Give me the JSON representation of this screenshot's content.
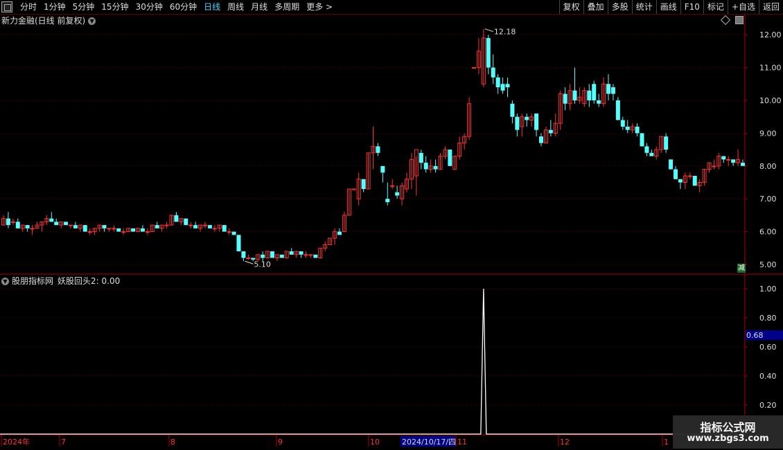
{
  "toolbar": {
    "periods": [
      "分时",
      "1分钟",
      "5分钟",
      "15分钟",
      "30分钟",
      "60分钟",
      "日线",
      "周线",
      "月线",
      "多周期",
      "更多 >"
    ],
    "active": "日线",
    "right_buttons": [
      "复权",
      "叠加",
      "多股",
      "统计",
      "画线",
      "F10",
      "标记",
      "+自选",
      "返回"
    ]
  },
  "main_chart": {
    "title": "新力金融(日线 前复权)",
    "y_ticks": [
      "12.00",
      "11.00",
      "10.00",
      "9.00",
      "8.00",
      "7.00",
      "6.00",
      "5.00"
    ],
    "annotations": {
      "high": "12.18",
      "low": "5.10"
    },
    "side_badge": "减"
  },
  "indicator": {
    "title": "股朋指标网",
    "formula_label": "妖股回头2: 0.00",
    "y_ticks": [
      "1.00",
      "0.80",
      "0.60",
      "0.40",
      "0.20"
    ],
    "cursor_value": "0.68"
  },
  "x_axis": {
    "labels": [
      "2024年",
      "7",
      "8",
      "9",
      "10",
      "11",
      "12",
      "1"
    ],
    "highlight": "2024/10/17/四"
  },
  "watermark": {
    "line1": "指标公式网",
    "line2": "www.zbgs3.com"
  },
  "colors": {
    "up": "#ff3232",
    "down": "#54ffff",
    "axis": "#b00000",
    "grid": "#5a0000",
    "indicator_line": "#ffffff"
  },
  "chart_data": {
    "type": "candlestick",
    "y_range": [
      5.0,
      12.2
    ],
    "indicator_y_range": [
      0,
      1.05
    ],
    "candles": [
      [
        6.2,
        6.5,
        6.2,
        6.4
      ],
      [
        6.4,
        6.6,
        6.1,
        6.2
      ],
      [
        6.3,
        6.4,
        6.2,
        6.3
      ],
      [
        6.3,
        6.4,
        6.1,
        6.1
      ],
      [
        6.1,
        6.2,
        6.0,
        6.2
      ],
      [
        6.2,
        6.2,
        6.0,
        6.1
      ],
      [
        6.1,
        6.2,
        5.9,
        6.1
      ],
      [
        6.1,
        6.3,
        6.1,
        6.2
      ],
      [
        6.2,
        6.3,
        6.0,
        6.3
      ],
      [
        6.3,
        6.5,
        6.2,
        6.4
      ],
      [
        6.4,
        6.6,
        6.3,
        6.3
      ],
      [
        6.3,
        6.4,
        6.2,
        6.2
      ],
      [
        6.2,
        6.3,
        6.1,
        6.3
      ],
      [
        6.3,
        6.3,
        6.2,
        6.2
      ],
      [
        6.2,
        6.2,
        6.1,
        6.2
      ],
      [
        6.2,
        6.3,
        6.1,
        6.1
      ],
      [
        6.1,
        6.2,
        6.0,
        6.2
      ],
      [
        6.2,
        6.2,
        6.0,
        6.0
      ],
      [
        6.0,
        6.1,
        5.9,
        6.0
      ],
      [
        6.0,
        6.1,
        5.9,
        6.1
      ],
      [
        6.1,
        6.2,
        6.0,
        6.2
      ],
      [
        6.2,
        6.2,
        6.0,
        6.1
      ],
      [
        6.1,
        6.1,
        6.0,
        6.1
      ],
      [
        6.1,
        6.2,
        6.0,
        6.1
      ],
      [
        6.1,
        6.1,
        6.0,
        6.0
      ],
      [
        6.0,
        6.1,
        5.9,
        6.0
      ],
      [
        6.0,
        6.1,
        6.0,
        6.1
      ],
      [
        6.1,
        6.1,
        6.0,
        6.0
      ],
      [
        6.0,
        6.1,
        6.0,
        6.1
      ],
      [
        6.1,
        6.2,
        6.0,
        6.0
      ],
      [
        6.0,
        6.1,
        5.9,
        6.0
      ],
      [
        6.0,
        6.2,
        6.0,
        6.2
      ],
      [
        6.2,
        6.3,
        6.1,
        6.1
      ],
      [
        6.1,
        6.2,
        6.0,
        6.2
      ],
      [
        6.2,
        6.3,
        6.1,
        6.2
      ],
      [
        6.2,
        6.5,
        6.2,
        6.5
      ],
      [
        6.5,
        6.6,
        6.3,
        6.3
      ],
      [
        6.3,
        6.4,
        6.2,
        6.4
      ],
      [
        6.4,
        6.4,
        6.2,
        6.2
      ],
      [
        6.2,
        6.3,
        6.1,
        6.2
      ],
      [
        6.2,
        6.3,
        6.1,
        6.1
      ],
      [
        6.1,
        6.2,
        6.0,
        6.2
      ],
      [
        6.2,
        6.3,
        6.1,
        6.2
      ],
      [
        6.2,
        6.2,
        6.1,
        6.1
      ],
      [
        6.1,
        6.2,
        6.0,
        6.1
      ],
      [
        6.1,
        6.2,
        6.0,
        6.2
      ],
      [
        6.2,
        6.2,
        6.0,
        6.0
      ],
      [
        6.0,
        6.1,
        5.9,
        6.0
      ],
      [
        6.0,
        6.0,
        5.9,
        5.9
      ],
      [
        5.9,
        5.9,
        5.4,
        5.4
      ],
      [
        5.4,
        5.4,
        5.1,
        5.2
      ],
      [
        5.2,
        5.3,
        5.15,
        5.2
      ],
      [
        5.2,
        5.2,
        5.1,
        5.15
      ],
      [
        5.15,
        5.3,
        5.1,
        5.3
      ],
      [
        5.3,
        5.4,
        5.1,
        5.2
      ],
      [
        5.2,
        5.4,
        5.2,
        5.4
      ],
      [
        5.4,
        5.4,
        5.2,
        5.2
      ],
      [
        5.2,
        5.3,
        5.1,
        5.3
      ],
      [
        5.3,
        5.3,
        5.2,
        5.2
      ],
      [
        5.2,
        5.4,
        5.2,
        5.4
      ],
      [
        5.4,
        5.5,
        5.3,
        5.3
      ],
      [
        5.3,
        5.4,
        5.2,
        5.4
      ],
      [
        5.4,
        5.4,
        5.2,
        5.3
      ],
      [
        5.3,
        5.4,
        5.2,
        5.3
      ],
      [
        5.3,
        5.3,
        5.2,
        5.3
      ],
      [
        5.3,
        5.3,
        5.2,
        5.2
      ],
      [
        5.2,
        5.5,
        5.2,
        5.5
      ],
      [
        5.5,
        5.7,
        5.4,
        5.6
      ],
      [
        5.6,
        5.8,
        5.6,
        5.8
      ],
      [
        5.8,
        6.1,
        5.6,
        6.0
      ],
      [
        6.0,
        6.1,
        5.9,
        5.9
      ],
      [
        6.0,
        6.6,
        6.0,
        6.5
      ],
      [
        6.5,
        7.3,
        6.5,
        7.3
      ],
      [
        7.3,
        7.3,
        7.3,
        7.3
      ],
      [
        7.0,
        7.8,
        6.8,
        7.6
      ],
      [
        7.6,
        7.6,
        7.2,
        7.3
      ],
      [
        7.3,
        8.4,
        7.3,
        8.4
      ],
      [
        8.4,
        9.2,
        7.9,
        8.6
      ],
      [
        8.6,
        8.7,
        8.3,
        8.4
      ],
      [
        8.0,
        8.0,
        7.5,
        7.8
      ],
      [
        7.0,
        7.5,
        6.8,
        6.9
      ],
      [
        7.4,
        7.6,
        7.3,
        7.4
      ],
      [
        7.2,
        7.4,
        7.0,
        7.1
      ],
      [
        7.0,
        7.5,
        6.8,
        7.4
      ],
      [
        7.3,
        7.8,
        7.2,
        7.6
      ],
      [
        7.6,
        8.4,
        7.3,
        8.2
      ],
      [
        7.7,
        8.3,
        7.1,
        8.5
      ],
      [
        8.4,
        8.5,
        7.9,
        8.1
      ],
      [
        8.1,
        8.3,
        7.8,
        7.9
      ],
      [
        7.9,
        8.2,
        7.8,
        8.0
      ],
      [
        8.0,
        8.2,
        7.8,
        7.9
      ],
      [
        7.9,
        8.4,
        7.9,
        8.3
      ],
      [
        8.3,
        8.6,
        8.2,
        8.5
      ],
      [
        8.5,
        8.5,
        8.0,
        8.0
      ],
      [
        7.9,
        8.3,
        7.9,
        8.3
      ],
      [
        8.3,
        8.9,
        8.2,
        8.7
      ],
      [
        8.7,
        9.0,
        8.5,
        8.9
      ],
      [
        8.9,
        10.1,
        8.8,
        9.9
      ],
      [
        11.0,
        11.0,
        11.0,
        11.0
      ],
      [
        11.0,
        11.9,
        10.8,
        11.5
      ],
      [
        10.5,
        12.18,
        10.4,
        11.9
      ],
      [
        11.9,
        12.0,
        10.8,
        11.0
      ],
      [
        11.0,
        11.4,
        10.5,
        10.7
      ],
      [
        10.7,
        10.8,
        10.2,
        10.4
      ],
      [
        10.5,
        10.7,
        10.2,
        10.3
      ],
      [
        10.5,
        10.7,
        10.1,
        10.4
      ],
      [
        9.9,
        10.0,
        9.3,
        9.5
      ],
      [
        9.5,
        9.6,
        8.9,
        9.1
      ],
      [
        9.2,
        9.6,
        8.9,
        9.5
      ],
      [
        9.5,
        9.6,
        9.2,
        9.4
      ],
      [
        9.4,
        9.6,
        9.2,
        9.5
      ],
      [
        9.6,
        9.6,
        8.9,
        9.1
      ],
      [
        8.9,
        9.0,
        8.6,
        8.7
      ],
      [
        8.7,
        9.2,
        8.7,
        9.1
      ],
      [
        9.1,
        9.4,
        8.9,
        9.0
      ],
      [
        9.0,
        9.6,
        8.9,
        9.3
      ],
      [
        9.3,
        10.3,
        9.1,
        10.2
      ],
      [
        10.2,
        10.4,
        9.7,
        9.9
      ],
      [
        9.9,
        10.5,
        9.7,
        10.3
      ],
      [
        10.3,
        11.0,
        9.9,
        10.0
      ],
      [
        10.0,
        10.4,
        9.9,
        10.1
      ],
      [
        9.9,
        10.4,
        9.8,
        10.3
      ],
      [
        10.3,
        10.5,
        9.8,
        10.0
      ],
      [
        10.5,
        10.6,
        9.9,
        10.0
      ],
      [
        10.0,
        10.2,
        9.8,
        9.9
      ],
      [
        9.9,
        10.7,
        9.8,
        10.5
      ],
      [
        10.5,
        10.8,
        10.0,
        10.2
      ],
      [
        10.4,
        10.5,
        10.0,
        10.2
      ],
      [
        10.0,
        10.1,
        9.4,
        9.4
      ],
      [
        9.4,
        9.5,
        9.1,
        9.2
      ],
      [
        9.2,
        9.4,
        9.0,
        9.1
      ],
      [
        9.1,
        9.3,
        9.0,
        9.2
      ],
      [
        9.2,
        9.3,
        8.9,
        9.0
      ],
      [
        9.0,
        9.0,
        8.6,
        8.6
      ],
      [
        8.6,
        8.7,
        8.3,
        8.4
      ],
      [
        8.4,
        8.5,
        8.3,
        8.3
      ],
      [
        8.3,
        8.6,
        8.2,
        8.5
      ],
      [
        8.5,
        8.9,
        8.4,
        8.9
      ],
      [
        8.9,
        9.0,
        8.4,
        8.5
      ],
      [
        8.2,
        8.2,
        7.9,
        7.9
      ],
      [
        7.9,
        8.0,
        7.6,
        7.6
      ],
      [
        7.6,
        7.6,
        7.3,
        7.5
      ],
      [
        7.5,
        7.8,
        7.3,
        7.7
      ],
      [
        7.7,
        7.8,
        7.6,
        7.7
      ],
      [
        7.7,
        7.7,
        7.4,
        7.4
      ],
      [
        7.4,
        7.6,
        7.2,
        7.5
      ],
      [
        7.5,
        7.9,
        7.4,
        7.9
      ],
      [
        7.9,
        8.1,
        7.8,
        8.1
      ],
      [
        8.0,
        8.2,
        7.9,
        8.0
      ],
      [
        8.0,
        8.4,
        7.9,
        8.3
      ],
      [
        8.3,
        8.3,
        8.1,
        8.2
      ],
      [
        8.2,
        8.3,
        8.0,
        8.2
      ],
      [
        8.2,
        8.2,
        8.0,
        8.1
      ],
      [
        8.1,
        8.5,
        8.0,
        8.2
      ],
      [
        8.1,
        8.2,
        8.0,
        8.0
      ]
    ],
    "indicator_series": {
      "name": "妖股回头2",
      "spike_at_index": 100,
      "spike_value": 1.0
    }
  }
}
